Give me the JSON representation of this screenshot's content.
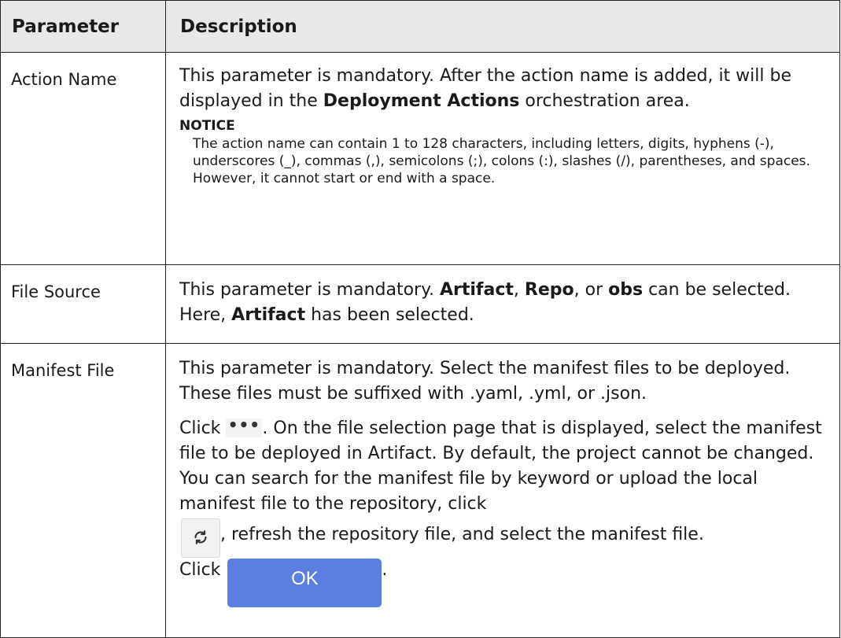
{
  "header": {
    "parameter": "Parameter",
    "description": "Description"
  },
  "rows": [
    {
      "name": "Action Name",
      "text_before": "This parameter is mandatory. After the action name is added, it will be displayed in the ",
      "bold_1": "Deployment Actions",
      "text_after": " orchestration area.",
      "notice_title": "NOTICE",
      "notice_body": "The action name can contain 1 to 128 characters, including letters, digits, hyphens (-), underscores (_), commas (,), semicolons (;), colons (:), slashes (/), parentheses, and spaces. However, it cannot start or end with a space."
    },
    {
      "name": "File Source",
      "t1": "This parameter is mandatory. ",
      "b1": "Artifact",
      "t2": ", ",
      "b2": "Repo",
      "t3": ", or ",
      "b3": "obs",
      "t4": " can be selected. Here, ",
      "b4": "Artifact",
      "t5": " has been selected."
    },
    {
      "name": "Manifest File",
      "p1": "This parameter is mandatory. Select the manifest files to be deployed. These files must be suffixed with .yaml, .yml, or .json.",
      "click1": "Click ",
      "after_dots": ". On the file selection page that is displayed, select the manifest file to be deployed in Artifact. By default, the project cannot be changed. You can search for the manifest file by keyword or upload the local manifest file to the repository, click",
      "after_refresh": ", refresh the repository file, and select the manifest file.",
      "click2": "Click ",
      "ok_label": "OK",
      "end": "."
    }
  ],
  "icons": {
    "more": "more-dots-icon",
    "refresh": "refresh-icon"
  },
  "colors": {
    "header_bg": "#e8e8e8",
    "ok_button": "#5b7fe0"
  }
}
